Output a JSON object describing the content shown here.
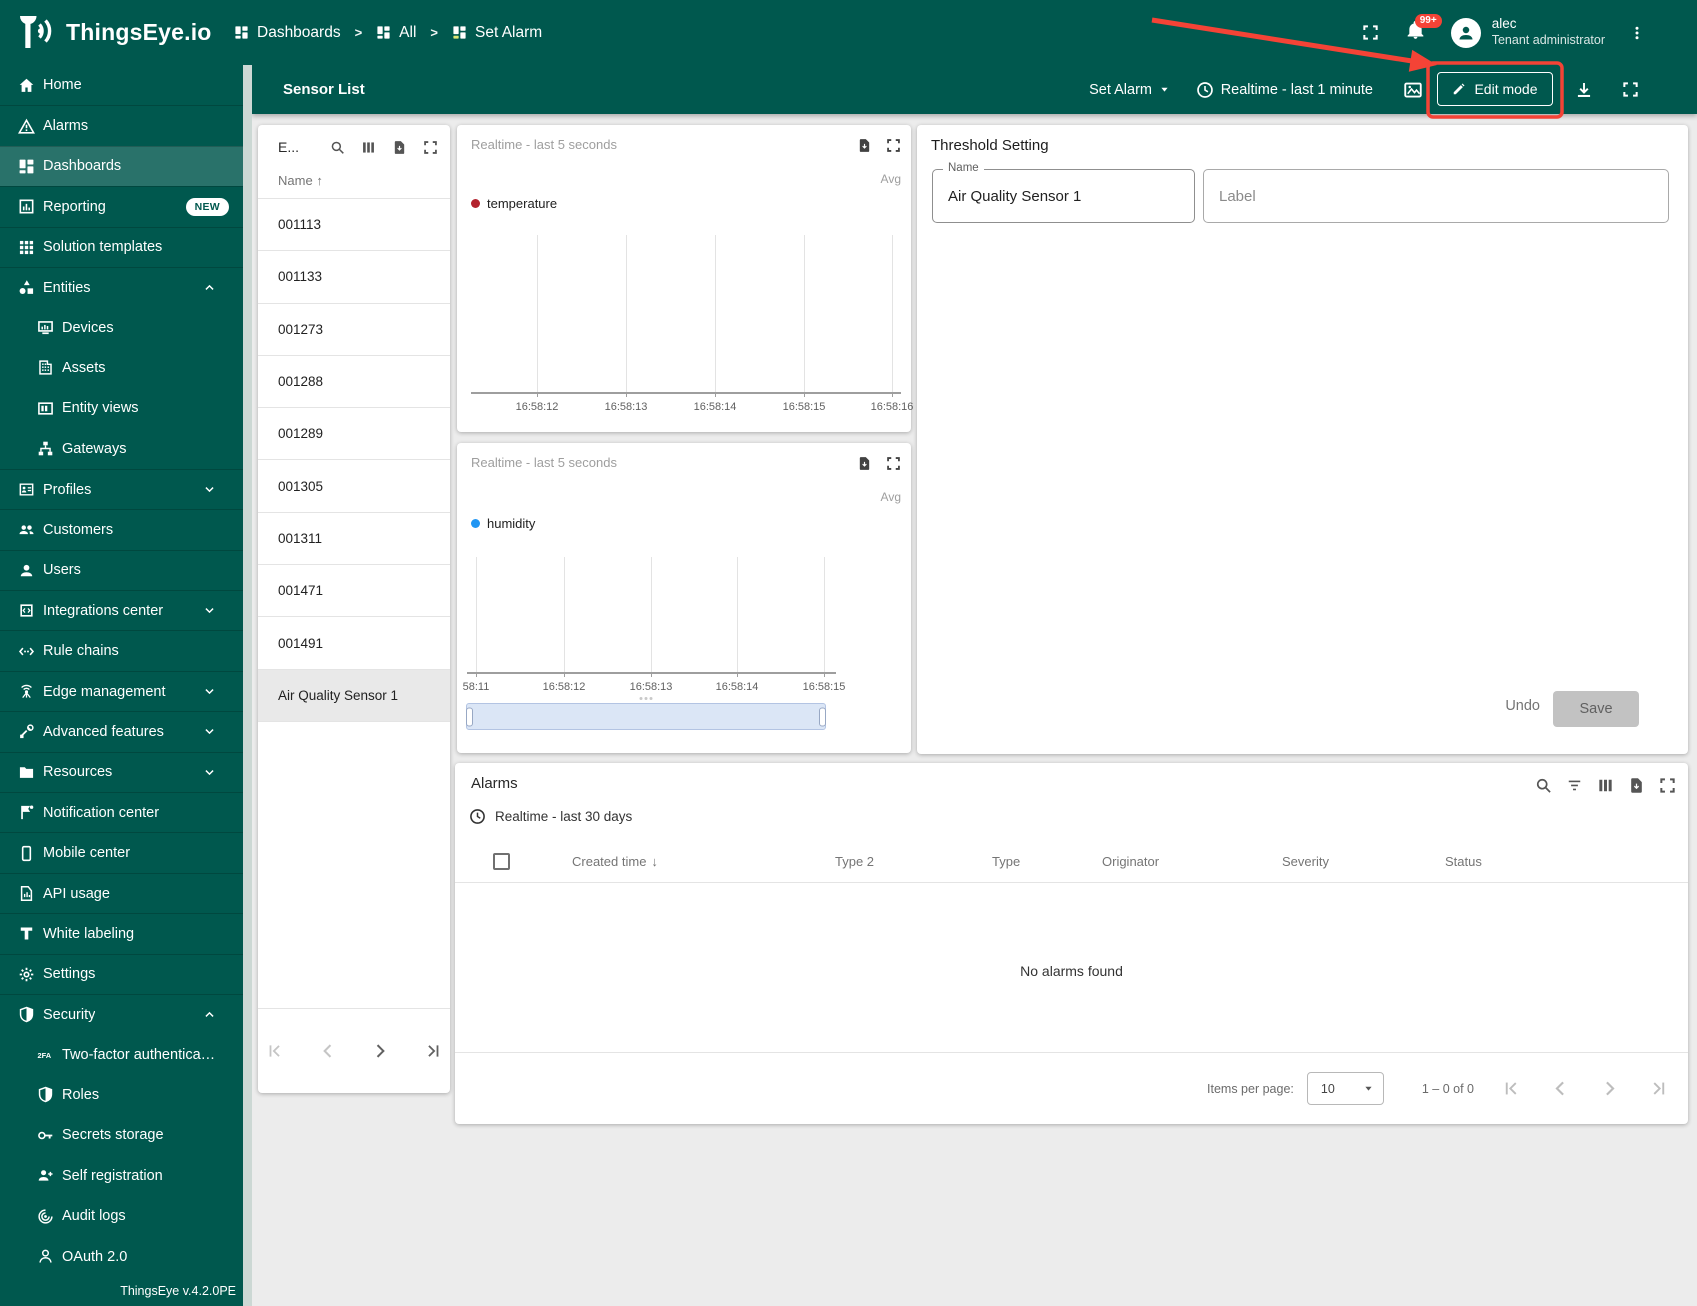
{
  "topbar": {
    "logo_text": "ThingsEye.io",
    "breadcrumbs": [
      "Dashboards",
      "All",
      "Set Alarm"
    ],
    "notifications_badge": "99+",
    "user": {
      "name": "alec",
      "role": "Tenant administrator"
    }
  },
  "toolbar": {
    "title": "Sensor List",
    "state_button": "Set Alarm",
    "timewindow": "Realtime - last 1 minute",
    "edit_button": "Edit mode"
  },
  "sidebar": {
    "footer": "ThingsEye v.4.2.0PE",
    "items": [
      {
        "label": "Home",
        "icon": "home",
        "level": 0
      },
      {
        "label": "Alarms",
        "icon": "warning",
        "level": 0
      },
      {
        "label": "Dashboards",
        "icon": "dashboard",
        "level": 0,
        "active": true
      },
      {
        "label": "Reporting",
        "icon": "reporting",
        "level": 0,
        "badge": "NEW"
      },
      {
        "label": "Solution templates",
        "icon": "apps",
        "level": 0
      },
      {
        "label": "Entities",
        "icon": "entities",
        "level": 0,
        "chevron": "up"
      },
      {
        "label": "Devices",
        "icon": "devices",
        "level": 1
      },
      {
        "label": "Assets",
        "icon": "assets",
        "level": 1
      },
      {
        "label": "Entity views",
        "icon": "entity-views",
        "level": 1
      },
      {
        "label": "Gateways",
        "icon": "gateways",
        "level": 1
      },
      {
        "label": "Profiles",
        "icon": "profiles",
        "level": 0,
        "chevron": "down"
      },
      {
        "label": "Customers",
        "icon": "customers",
        "level": 0
      },
      {
        "label": "Users",
        "icon": "users",
        "level": 0
      },
      {
        "label": "Integrations center",
        "icon": "integrations",
        "level": 0,
        "chevron": "down"
      },
      {
        "label": "Rule chains",
        "icon": "rule-chains",
        "level": 0
      },
      {
        "label": "Edge management",
        "icon": "edge",
        "level": 0,
        "chevron": "down"
      },
      {
        "label": "Advanced features",
        "icon": "advanced",
        "level": 0,
        "chevron": "down"
      },
      {
        "label": "Resources",
        "icon": "resources",
        "level": 0,
        "chevron": "down"
      },
      {
        "label": "Notification center",
        "icon": "notification",
        "level": 0
      },
      {
        "label": "Mobile center",
        "icon": "mobile",
        "level": 0
      },
      {
        "label": "API usage",
        "icon": "api",
        "level": 0
      },
      {
        "label": "White labeling",
        "icon": "white-labeling",
        "level": 0
      },
      {
        "label": "Settings",
        "icon": "settings",
        "level": 0
      },
      {
        "label": "Security",
        "icon": "security",
        "level": 0,
        "chevron": "up"
      },
      {
        "label": "Two-factor authenticati…",
        "icon": "2fa",
        "level": 1
      },
      {
        "label": "Roles",
        "icon": "roles",
        "level": 1
      },
      {
        "label": "Secrets storage",
        "icon": "key",
        "level": 1
      },
      {
        "label": "Self registration",
        "icon": "person-add",
        "level": 1
      },
      {
        "label": "Audit logs",
        "icon": "audit",
        "level": 1
      },
      {
        "label": "OAuth 2.0",
        "icon": "oauth",
        "level": 1
      }
    ]
  },
  "entity_list": {
    "title": "E...",
    "name_column": "Name",
    "rows": [
      "001113",
      "001133",
      "001273",
      "001288",
      "001289",
      "001305",
      "001311",
      "001471",
      "001491"
    ],
    "selected_row": "Air Quality Sensor 1"
  },
  "threshold": {
    "title": "Threshold Setting",
    "name_label": "Name",
    "name_value": "Air Quality Sensor 1",
    "label_placeholder": "Label",
    "undo_label": "Undo",
    "save_label": "Save"
  },
  "alarms": {
    "title": "Alarms",
    "timewindow": "Realtime - last 30 days",
    "columns": [
      "Created time",
      "Type 2",
      "Type",
      "Originator",
      "Severity",
      "Status"
    ],
    "empty_text": "No alarms found",
    "paginator": {
      "items_per_page_label": "Items per page:",
      "page_size": "10",
      "range_label": "1 – 0 of 0"
    }
  },
  "colors": {
    "brand_teal": "#00584e",
    "accent_red": "#f44336",
    "temperature_series": "#b3232e",
    "humidity_series": "#2196f3"
  },
  "chart_data": [
    {
      "type": "line",
      "title": "Realtime - last 5 seconds",
      "aggregation_label": "Avg",
      "series": [
        {
          "name": "temperature",
          "color": "#b3232e",
          "values": []
        }
      ],
      "x_ticks": [
        "16:58:12",
        "16:58:13",
        "16:58:14",
        "16:58:15",
        "16:58:16"
      ],
      "ylabel": "",
      "grid": true,
      "legend_position": "top-left"
    },
    {
      "type": "line",
      "title": "Realtime - last 5 seconds",
      "aggregation_label": "Avg",
      "series": [
        {
          "name": "humidity",
          "color": "#2196f3",
          "values": []
        }
      ],
      "x_ticks": [
        "58:11",
        "16:58:12",
        "16:58:13",
        "16:58:14",
        "16:58:15"
      ],
      "ylabel": "",
      "grid": true,
      "legend_position": "top-left",
      "has_range_selector": true
    }
  ]
}
